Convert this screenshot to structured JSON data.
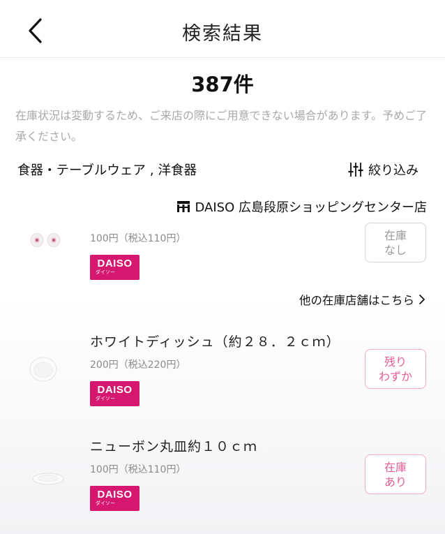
{
  "header": {
    "title": "検索結果"
  },
  "results": {
    "count": "387件",
    "notice": "在庫状況は変動するため、ご来店の際にご用意できない場合があります。予めご了承ください。"
  },
  "filter": {
    "category": "食器・テーブルウェア , 洋食器",
    "button_label": "絞り込み"
  },
  "store": {
    "name": "DAISO 広島段原ショッピングセンター店"
  },
  "products": [
    {
      "name": "",
      "price": "100円（税込110円）",
      "stock_line1": "在庫",
      "stock_line2": "なし",
      "stock_status_color": "#9a9a9a"
    },
    {
      "name": "ホワイトディッシュ（約２８．２ｃｍ）",
      "price": "200円（税込220円）",
      "stock_line1": "残り",
      "stock_line2": "わずか",
      "stock_status_color": "#e45c97"
    },
    {
      "name": "ニューボン丸皿約１０ｃｍ",
      "price": "100円（税込110円）",
      "stock_line1": "在庫",
      "stock_line2": "あり",
      "stock_status_color": "#e45c97"
    }
  ],
  "brand_badge": {
    "main": "DAISO",
    "sub": "ダイソー",
    "color": "#d6176f"
  },
  "other_stores_link": "他の在庫店舗はこちら"
}
